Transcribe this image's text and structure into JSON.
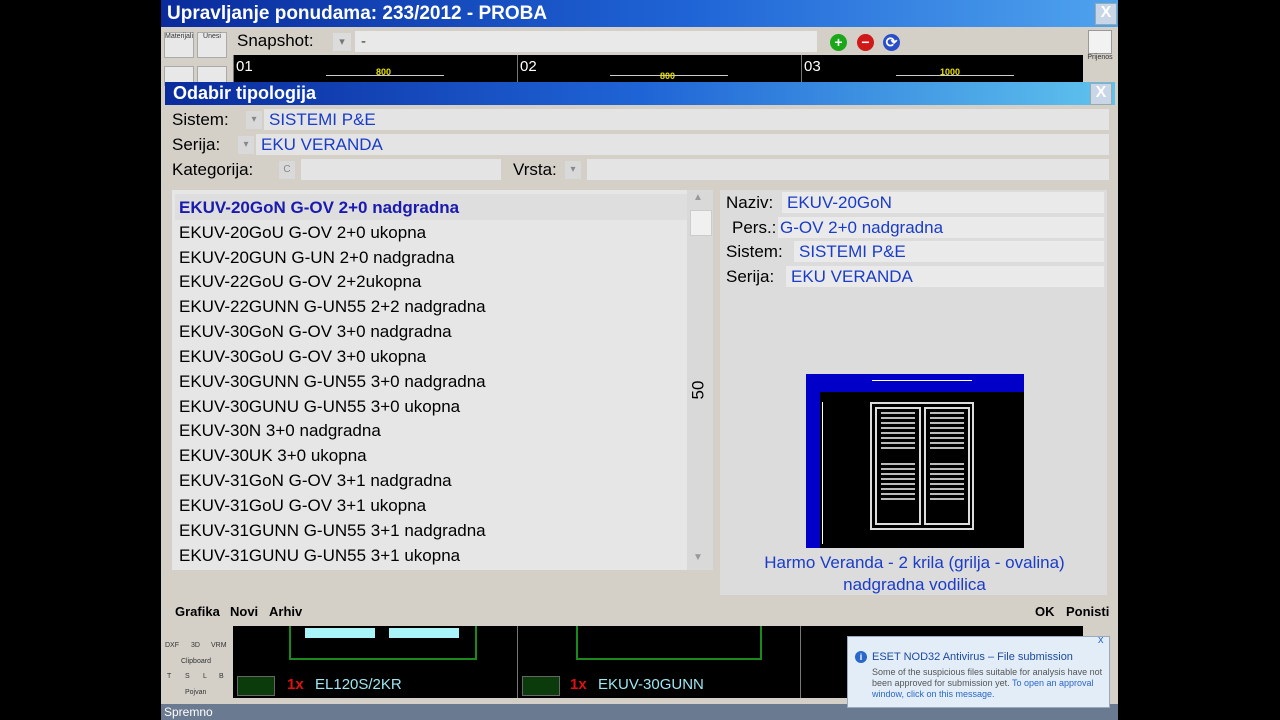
{
  "window": {
    "title": "Upravljanje ponudama: 233/2012 - PROBA",
    "close": "X"
  },
  "toolbar": {
    "materijali": "Materijali",
    "unesi": "Unesi",
    "snapshot_label": "Snapshot:",
    "snapshot_value": "-",
    "add": "+",
    "remove": "−",
    "refresh": "⟳",
    "prijenos": "Prijenos"
  },
  "drawings": {
    "cells": [
      {
        "num": "01",
        "dim": "800"
      },
      {
        "num": "02",
        "dim": "800"
      },
      {
        "num": "03",
        "dim": "1000"
      }
    ]
  },
  "dialog": {
    "title": "Odabir tipologija",
    "close": "X",
    "sistem_label": "Sistem:",
    "sistem_value": "SISTEMI P&E",
    "serija_label": "Serija:",
    "serija_value": "EKU VERANDA",
    "kategorija_label": "Kategorija:",
    "kategorija_btn": "C",
    "vrsta_label": "Vrsta:"
  },
  "list": {
    "items": [
      "EKUV-20GoN G-OV 2+0 nadgradna",
      "EKUV-20GoU G-OV 2+0 ukopna",
      "EKUV-20GUN G-UN 2+0 nadgradna",
      "EKUV-22GoU G-OV 2+2ukopna",
      "EKUV-22GUNN G-UN55 2+2 nadgradna",
      "EKUV-30GoN G-OV 3+0 nadgradna",
      "EKUV-30GoU G-OV 3+0 ukopna",
      "EKUV-30GUNN G-UN55 3+0 nadgradna",
      "EKUV-30GUNU G-UN55 3+0 ukopna",
      "EKUV-30N 3+0 nadgradna",
      "EKUV-30UK 3+0 ukopna",
      "EKUV-31GoN G-OV 3+1 nadgradna",
      "EKUV-31GoU G-OV 3+1 ukopna",
      "EKUV-31GUNN G-UN55 3+1 nadgradna",
      "EKUV-31GUNU G-UN55 3+1 ukopna"
    ],
    "scroll_count": "50"
  },
  "detail": {
    "naziv_label": "Naziv:",
    "naziv_value": "EKUV-20GoN",
    "pers_label": "Pers.:",
    "pers_value": "G-OV 2+0 nadgradna",
    "sistem_label": "Sistem:",
    "sistem_value": "SISTEMI P&E",
    "serija_label": "Serija:",
    "serija_value": "EKU VERANDA",
    "caption_line1": "Harmo Veranda - 2 krila (grilja - ovalina)",
    "caption_line2": "nadgradna vodilica"
  },
  "buttons": {
    "grafika": "Grafika",
    "novi": "Novi",
    "arhiv": "Arhiv",
    "ok": "OK",
    "ponisti": "Ponisti"
  },
  "bottom": {
    "side": {
      "dxf": "DXF",
      "d3": "3D",
      "vrm": "VRM",
      "clipboard": "Clipboard",
      "t": "T",
      "s": "S",
      "l": "L",
      "b": "B",
      "pojvan": "Pojvan"
    },
    "rows": [
      {
        "qty": "1x",
        "code": "EL120S/2KR"
      },
      {
        "qty": "1x",
        "code": "EKUV-30GUNN"
      }
    ]
  },
  "status": {
    "text": "Spremno"
  },
  "eset": {
    "title": "ESET NOD32 Antivirus – File submission",
    "body": "Some of the suspicious files suitable for analysis have not been approved for submission yet.",
    "link": "To open an approval window, click on this message.",
    "close": "x"
  },
  "colors": {
    "title_blue": "#0a2b9c",
    "field_text": "#1a3cc8",
    "preview_frame": "#0000c8"
  }
}
